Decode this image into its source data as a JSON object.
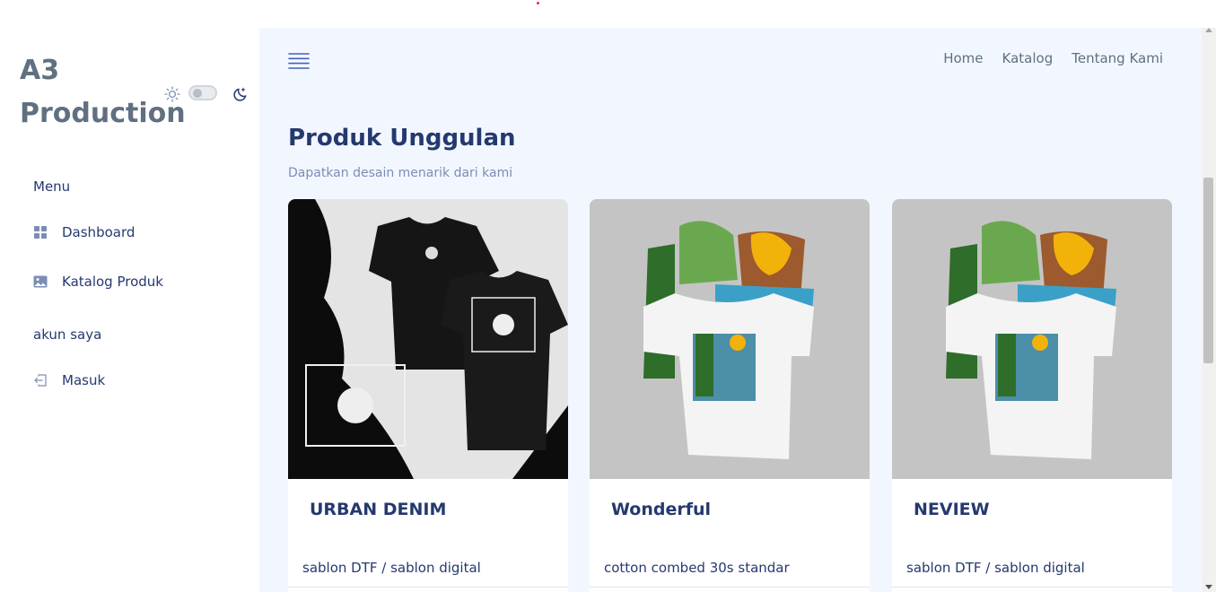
{
  "brand": {
    "title": "A3 Production"
  },
  "sidebar": {
    "section_menu": "Menu",
    "items": [
      {
        "label": "Dashboard",
        "icon": "grid-icon"
      },
      {
        "label": "Katalog Produk",
        "icon": "image-icon"
      }
    ],
    "section_account": "akun saya",
    "account_items": [
      {
        "label": "Masuk",
        "icon": "login-icon"
      }
    ]
  },
  "theme_toggle": {
    "mode": "light",
    "icons": [
      "sun-icon",
      "moon-icon"
    ]
  },
  "topnav": {
    "links": [
      "Home",
      "Katalog",
      "Tentang Kami"
    ]
  },
  "main": {
    "title": "Produk Unggulan",
    "subtitle": "Dapatkan desain menarik dari kami"
  },
  "products": [
    {
      "name": "URBAN DENIM",
      "description": "sablon DTF / sablon digital",
      "image": "black-tshirt-never-stress-photo"
    },
    {
      "name": "Wonderful",
      "description": "cotton combed 30s standar",
      "image": "white-tshirt-wonderful-print-photo"
    },
    {
      "name": "NEVIEW",
      "description": "sablon DTF / sablon digital",
      "image": "white-tshirt-wonderful-print-photo"
    }
  ],
  "colors": {
    "primary_text": "#25396f",
    "muted_text": "#607080",
    "main_background": "#f2f7ff",
    "card_background": "#ffffff"
  }
}
